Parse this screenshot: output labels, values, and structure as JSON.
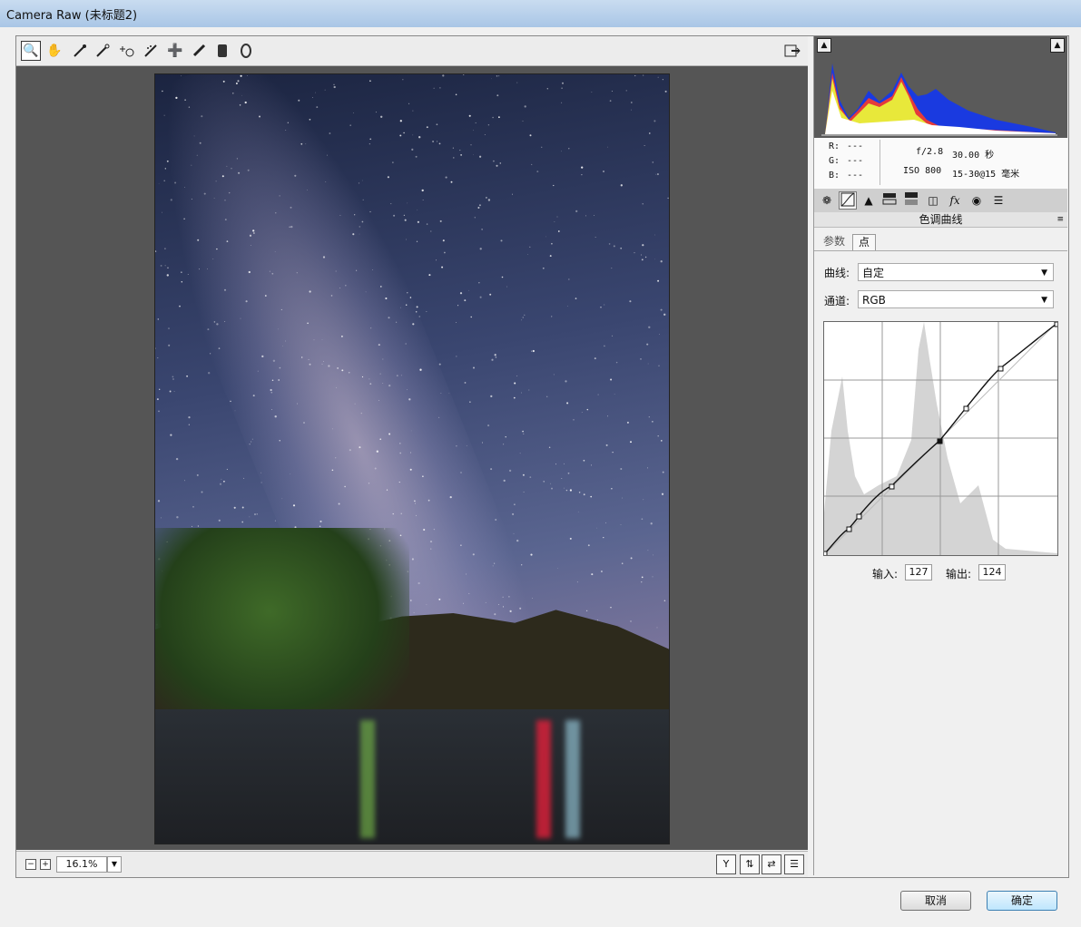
{
  "window": {
    "title": "Camera Raw (未标题2)"
  },
  "toolbar": {
    "tools": [
      "zoom-icon",
      "hand-icon",
      "white-balance-icon",
      "color-sampler-icon",
      "targeted-adjust-icon",
      "crop-icon",
      "red-eye-icon",
      "adjustment-brush-icon",
      "graduated-filter-icon",
      "radial-filter-icon"
    ],
    "glyphs": [
      "🔍",
      "✋",
      "⁄",
      "✎",
      "⌖",
      "⟋",
      "👁",
      "🖌",
      "▮",
      "⬭"
    ]
  },
  "status": {
    "zoom_value": "16.1%"
  },
  "readout": {
    "r_label": "R:",
    "r_value": "---",
    "g_label": "G:",
    "g_value": "---",
    "b_label": "B:",
    "b_value": "---",
    "aperture": "f/2.8",
    "shutter": "30.00 秒",
    "iso": "ISO 800",
    "lens": "15-30@15 毫米"
  },
  "panel": {
    "section_title": "色调曲线",
    "subtabs": [
      "参数",
      "点"
    ],
    "curve_label": "曲线:",
    "curve_value": "自定",
    "channel_label": "通道:",
    "channel_value": "RGB",
    "input_label": "输入:",
    "input_value": "127",
    "output_label": "输出:",
    "output_value": "124"
  },
  "buttons": {
    "cancel": "取消",
    "ok": "确定"
  },
  "colors": {
    "accent": "#3c7fb1",
    "preview_bg": "#555555"
  }
}
